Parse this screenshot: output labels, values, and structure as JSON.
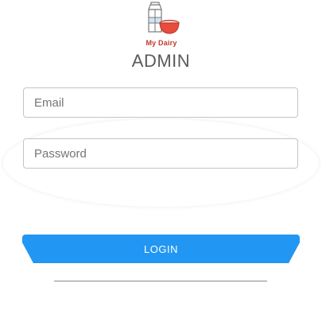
{
  "brand": {
    "logo_icon": "dairy-carton-bowl-icon",
    "name": "My Dairy"
  },
  "header": {
    "title": "ADMIN"
  },
  "form": {
    "email_placeholder": "Email",
    "email_value": "",
    "password_placeholder": "Password",
    "password_value": "",
    "login_label": "LOGIN"
  },
  "colors": {
    "accent": "#2196f3",
    "brand_red": "#c0392b",
    "title_gray": "#5a5a5a"
  }
}
